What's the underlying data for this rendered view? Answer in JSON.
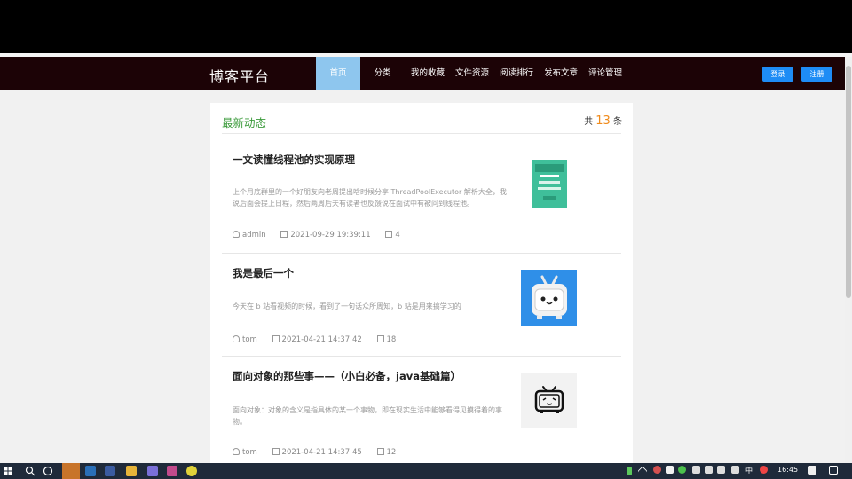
{
  "nav": {
    "logo": "博客平台",
    "items": [
      "首页",
      "分类",
      "我的收藏",
      "文件资源",
      "阅读排行",
      "发布文章",
      "评论管理"
    ],
    "login": "登录",
    "register": "注册"
  },
  "feed": {
    "title": "最新动态",
    "count_prefix": "共",
    "count": "13",
    "count_suffix": "条",
    "articles": [
      {
        "title": "一文读懂线程池的实现原理",
        "desc": "上个月底群里的一个好朋友向老周提出啥时候分享 ThreadPoolExecutor 解析大全，我说后面会提上日程，然后两周后天有读者也反馈说在面试中有被问到线程池。",
        "author": "admin",
        "date": "2021-09-29 19:39:11",
        "comments": "4"
      },
      {
        "title": "我是最后一个",
        "desc": "今天在 b 站看视频的时候，看到了一句话众所周知，b 站是用来搞学习的",
        "author": "tom",
        "date": "2021-04-21 14:37:42",
        "comments": "18"
      },
      {
        "title": "面向对象的那些事——（小白必备，java基础篇）",
        "desc": "面向对象：对象的含义是指具体的某一个事物，即在现实生活中能够看得见摸得着的事物。",
        "author": "tom",
        "date": "2021-04-21 14:37:45",
        "comments": "12"
      }
    ]
  },
  "taskbar": {
    "ime": "中",
    "time": "16:45"
  },
  "colors": {
    "nav_bg": "#1c0306",
    "nav_active": "#8ec6ee",
    "button_blue": "#1e8cf5",
    "title_green": "#3a9a3a",
    "count_orange": "#f08b1c"
  }
}
